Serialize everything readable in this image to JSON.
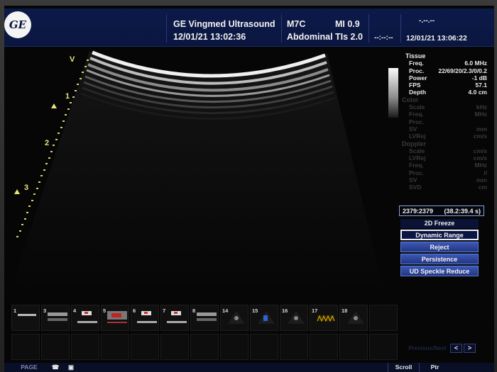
{
  "header": {
    "logo": "GE",
    "system_name": "GE Vingmed Ultrasound",
    "date_time": "12/01/21 13:02:36",
    "probe": "M7C",
    "preset": "Abdominal",
    "mi": "MI 0.9",
    "tis": "TIs 2.0",
    "hr_placeholder_top": "-.--.--",
    "hr_placeholder": "--:--:--",
    "right_date_time": "12/01/21 13:06:22"
  },
  "scale": {
    "v_marker": "V",
    "depth_labels": [
      "1",
      "2",
      "3"
    ]
  },
  "parameters": {
    "tissue": {
      "heading": "Tissue",
      "rows": [
        {
          "label": "Freq.",
          "value": "6.0  MHz"
        },
        {
          "label": "Proc.",
          "value": "22/69/20/2.3/0/0.2"
        },
        {
          "label": "Power",
          "value": "-1  dB"
        },
        {
          "label": "FPS",
          "value": "57.1"
        },
        {
          "label": "Depth",
          "value": "4.0  cm"
        }
      ]
    },
    "color": {
      "heading": "Color",
      "rows": [
        {
          "label": "Scale",
          "value": "kHz"
        },
        {
          "label": "Freq.",
          "value": "MHz"
        },
        {
          "label": "Proc.",
          "value": ""
        },
        {
          "label": "SV",
          "value": "mm"
        },
        {
          "label": "LVRej",
          "value": "cm/s"
        }
      ]
    },
    "doppler": {
      "heading": "Doppler",
      "rows": [
        {
          "label": "Scale",
          "value": "cm/s"
        },
        {
          "label": "LVRej",
          "value": "cm/s"
        },
        {
          "label": "Freq.",
          "value": "MHz"
        },
        {
          "label": "Proc.",
          "value": "//"
        },
        {
          "label": "SV",
          "value": "mm"
        },
        {
          "label": "SVD",
          "value": "cm"
        }
      ]
    }
  },
  "frame_counter": {
    "frames": "2379:2379",
    "time": "(38.2:39.4 s)"
  },
  "menu": {
    "title": "2D Freeze",
    "items": [
      "Dynamic Range",
      "Reject",
      "Persistence",
      "UD Speckle Reduce"
    ],
    "active_index": 0
  },
  "clipboard": {
    "thumbnails": [
      {
        "num": "1",
        "kind": "line"
      },
      {
        "num": "3",
        "kind": "bmode"
      },
      {
        "num": "4",
        "kind": "spectral"
      },
      {
        "num": "5",
        "kind": "color"
      },
      {
        "num": "6",
        "kind": "spectral"
      },
      {
        "num": "7",
        "kind": "spectral"
      },
      {
        "num": "8",
        "kind": "bmode"
      },
      {
        "num": "14",
        "kind": "sector"
      },
      {
        "num": "15",
        "kind": "sector-color"
      },
      {
        "num": "16",
        "kind": "sector"
      },
      {
        "num": "17",
        "kind": "doppler-yellow"
      },
      {
        "num": "18",
        "kind": "sector"
      }
    ],
    "page_label": "Previous/Next",
    "prev": "<",
    "next": ">"
  },
  "bottom_bar": {
    "left_label": "PAGE",
    "scroll": "Scroll",
    "ptr": "Ptr"
  },
  "colors": {
    "header_bg": "#0b1640",
    "accent_blue": "#2d46a8",
    "scale_yellow": "#e8e37a"
  }
}
